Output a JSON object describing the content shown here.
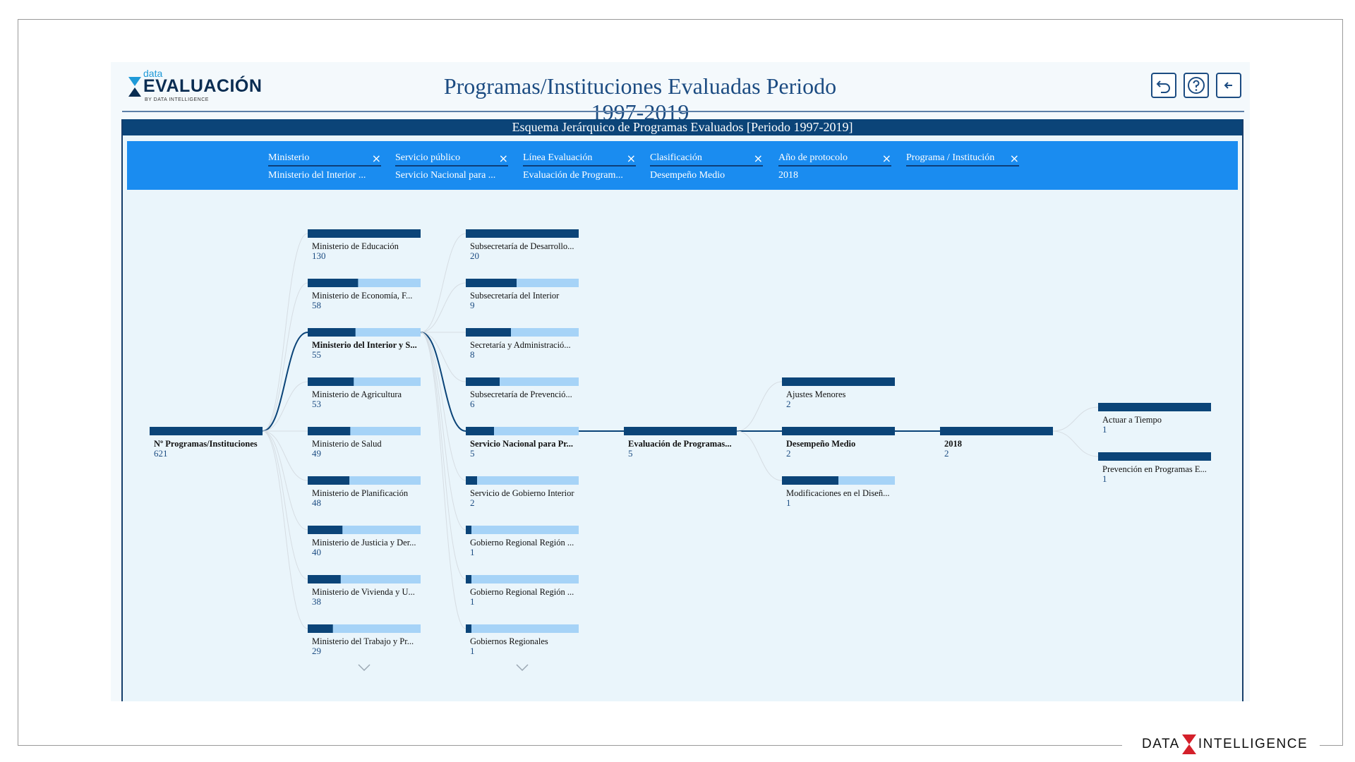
{
  "app": {
    "logo_small": "data",
    "logo_main": "EVALUACIÓN",
    "logo_by": "BY DATA INTELLIGENCE",
    "title": "Programas/Instituciones Evaluadas Periodo 1997-2019",
    "footer_brand_left": "DATA",
    "footer_brand_right": "INTELLIGENCE",
    "buttons": {
      "undo": "undo-icon",
      "help": "help-icon",
      "back": "back-arrow-icon"
    }
  },
  "chart": {
    "title": "Esquema Jerárquico de Programas Evaluados [Periodo 1997-2019]",
    "filters": [
      {
        "label": "Ministerio",
        "value": "Ministerio del Interior ..."
      },
      {
        "label": "Servicio público",
        "value": "Servicio Nacional para ..."
      },
      {
        "label": "Línea Evaluación",
        "value": "Evaluación de Program..."
      },
      {
        "label": "Clasificación",
        "value": "Desempeño Medio"
      },
      {
        "label": "Año de protocolo",
        "value": "2018"
      },
      {
        "label": "Programa / Institución",
        "value": ""
      }
    ],
    "close_glyph": "×"
  },
  "chart_data": {
    "type": "tree",
    "colors": {
      "bar_fill": "#0b4478",
      "bar_track": "#a6d3f7",
      "link": "#d6dde3",
      "active_link": "#0b4478"
    },
    "root": {
      "label": "Nº Programas/Instituciones",
      "value": 621
    },
    "levels": [
      {
        "name": "Ministerio",
        "nodes": [
          {
            "label": "Ministerio de Educación",
            "value": 130
          },
          {
            "label": "Ministerio de Economía, F...",
            "value": 58
          },
          {
            "label": "Ministerio del Interior y S...",
            "value": 55,
            "selected": true
          },
          {
            "label": "Ministerio de Agricultura",
            "value": 53
          },
          {
            "label": "Ministerio de Salud",
            "value": 49
          },
          {
            "label": "Ministerio de Planificación",
            "value": 48
          },
          {
            "label": "Ministerio de Justicia y Der...",
            "value": 40
          },
          {
            "label": "Ministerio de Vivienda y U...",
            "value": 38
          },
          {
            "label": "Ministerio del Trabajo y Pr...",
            "value": 29
          }
        ]
      },
      {
        "name": "Servicio público",
        "nodes": [
          {
            "label": "Subsecretaría de Desarrollo...",
            "value": 20
          },
          {
            "label": "Subsecretaría del Interior",
            "value": 9
          },
          {
            "label": "Secretaría y Administració...",
            "value": 8
          },
          {
            "label": "Subsecretaría de Prevenció...",
            "value": 6
          },
          {
            "label": "Servicio Nacional para Pr...",
            "value": 5,
            "selected": true
          },
          {
            "label": "Servicio de Gobierno Interior",
            "value": 2
          },
          {
            "label": "Gobierno Regional Región ...",
            "value": 1
          },
          {
            "label": "Gobierno Regional Región ...",
            "value": 1
          },
          {
            "label": "Gobiernos Regionales",
            "value": 1
          }
        ]
      },
      {
        "name": "Línea Evaluación",
        "nodes": [
          {
            "label": "Evaluación de Programas...",
            "value": 5,
            "selected": true
          }
        ]
      },
      {
        "name": "Clasificación",
        "nodes": [
          {
            "label": "Ajustes Menores",
            "value": 2
          },
          {
            "label": "Desempeño Medio",
            "value": 2,
            "selected": true
          },
          {
            "label": "Modificaciones en el Diseñ...",
            "value": 1
          }
        ]
      },
      {
        "name": "Año de protocolo",
        "nodes": [
          {
            "label": "2018",
            "value": 2,
            "selected": true
          }
        ]
      },
      {
        "name": "Programa / Institución",
        "nodes": [
          {
            "label": "Actuar a Tiempo",
            "value": 1
          },
          {
            "label": "Prevención en Programas E...",
            "value": 1
          }
        ]
      }
    ]
  }
}
